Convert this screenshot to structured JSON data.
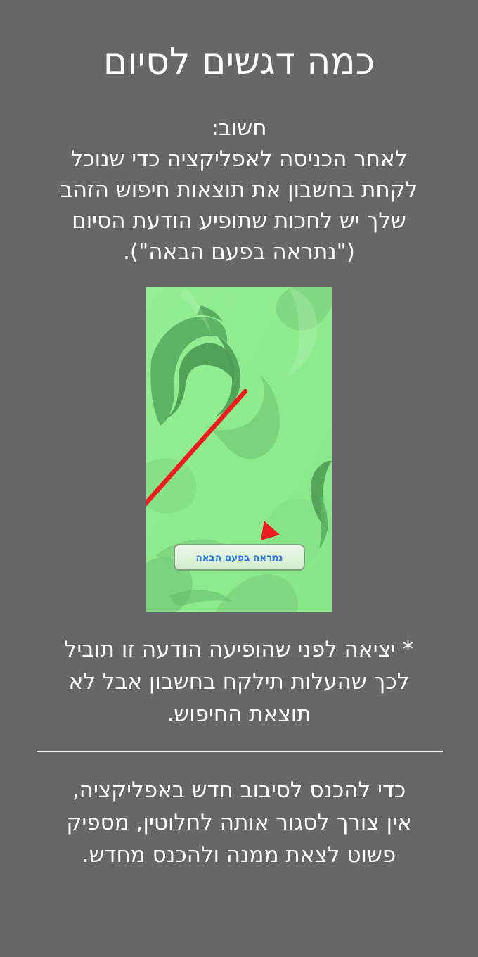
{
  "page": {
    "title": "כמה דגשים לסיום"
  },
  "important": {
    "label": "חשוב:",
    "lines": [
      "לאחר הכניסה לאפליקציה כדי שנוכל",
      "לקחת בחשבון את תוצאות חיפוש הזהב",
      "שלך יש לחכות שתופיע הודעת הסיום",
      "(\"נתראה בפעם הבאה\")."
    ]
  },
  "embedded_screenshot": {
    "button_label": "נתראה בפעם הבאה",
    "background_color": "#8cea8d",
    "arrow_color": "#ee1c1c"
  },
  "note": {
    "lines": [
      "* יציאה לפני שהופיעה הודעה זו תוביל",
      "לכך שהעלות תילקח בחשבון אבל לא",
      "תוצאת החיפוש."
    ]
  },
  "tip": {
    "lines": [
      "כדי להכנס לסיבוב חדש באפליקציה,",
      "אין צורך לסגור אותה לחלוטין, מספיק",
      "פשוט לצאת ממנה ולהכנס מחדש."
    ]
  }
}
